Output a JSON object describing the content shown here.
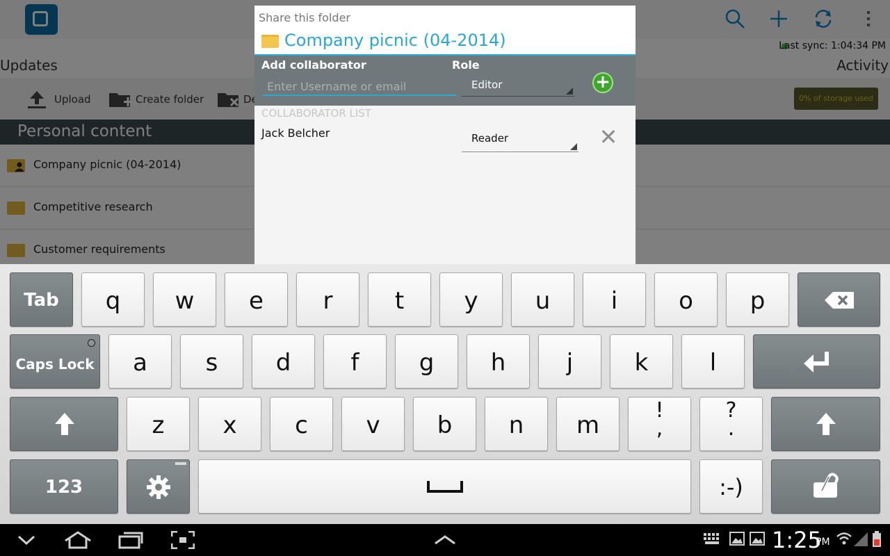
{
  "app": {
    "tabs": {
      "updates": "Updates",
      "activity": "Activity"
    },
    "last_sync": "Last sync: 1:04:34 PM",
    "toolbar": {
      "upload": "Upload",
      "create_folder": "Create folder",
      "delete_partial": "De"
    },
    "storage_badge": "0% of storage used",
    "section_title": "Personal content",
    "folders": [
      {
        "name": "Company picnic (04-2014)"
      },
      {
        "name": "Competitive research"
      },
      {
        "name": "Customer requirements"
      }
    ]
  },
  "dialog": {
    "caption": "Share this folder",
    "folder_name": "Company picnic (04-2014)",
    "add_collaborator_label": "Add collaborator",
    "role_label": "Role",
    "input_placeholder": "Enter Username or email",
    "input_value": "",
    "role_selected": "Editor",
    "list_heading": "COLLABORATOR LIST",
    "collaborators": [
      {
        "name": "Jack Belcher",
        "role": "Reader"
      }
    ]
  },
  "keyboard": {
    "row1": [
      "q",
      "w",
      "e",
      "r",
      "t",
      "y",
      "u",
      "i",
      "o",
      "p"
    ],
    "row2": [
      "a",
      "s",
      "d",
      "f",
      "g",
      "h",
      "j",
      "k",
      "l"
    ],
    "row3": [
      "z",
      "x",
      "c",
      "v",
      "b",
      "n",
      "m"
    ],
    "tab": "Tab",
    "caps": "Caps Lock",
    "num": "123",
    "punct1": "!\n,",
    "punct2": "?\n.",
    "emoticon": ":-)"
  },
  "statusbar": {
    "time": "1:25",
    "ampm": "PM"
  },
  "colors": {
    "accent": "#2aa9d8",
    "add_green": "#3ea52e",
    "section_bg": "#3b4a4e"
  }
}
